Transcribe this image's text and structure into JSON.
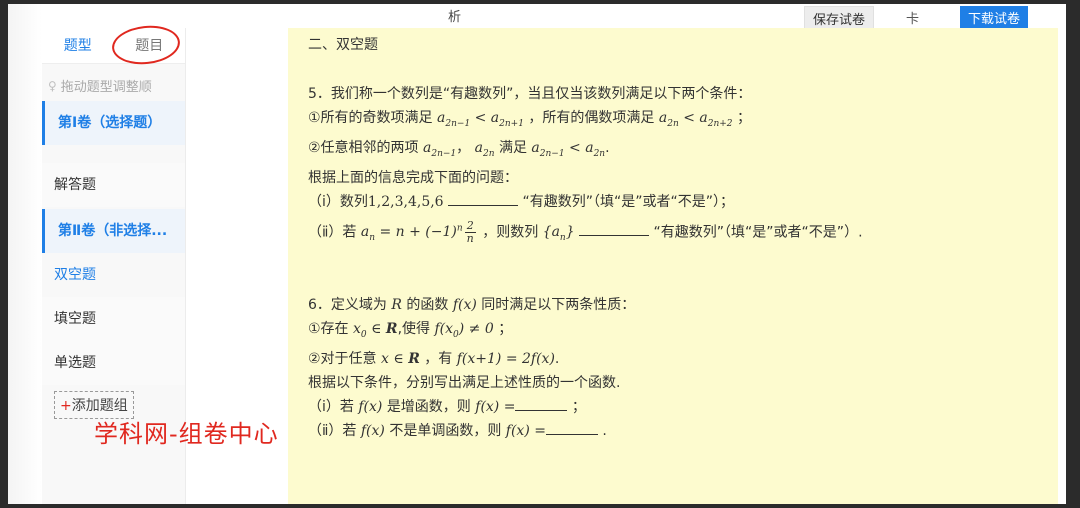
{
  "topbar": {
    "cut_text": "析",
    "save_label": "保存试卷",
    "card_label": "卡",
    "download_label": "下载试卷"
  },
  "sidebar": {
    "tabs": [
      {
        "label": "题型",
        "active": true
      },
      {
        "label": "题目",
        "active": false
      }
    ],
    "drag_tip": "拖动题型调整顺",
    "sections": [
      {
        "label": "第Ⅰ卷（选择题）",
        "kind": "volume"
      },
      {
        "label": "解答题",
        "kind": "plain"
      },
      {
        "label": "第Ⅱ卷（非选择...",
        "kind": "volume"
      },
      {
        "label": "双空题",
        "kind": "selected"
      },
      {
        "label": "填空题",
        "kind": "plain"
      },
      {
        "label": "单选题",
        "kind": "plain"
      }
    ],
    "add_group": {
      "plus": "+",
      "label": "添加题组"
    }
  },
  "watermark": "学科网-组卷中心",
  "paper": {
    "section_heading": "二、双空题",
    "q5": {
      "stem": "5．我们称一个数列是“有趣数列”，当且仅当该数列满足以下两个条件：",
      "c1_prefix": "①所有的奇数项满足",
      "c1_mid": "，所有的偶数项满足",
      "c1_end": "；",
      "c2_prefix": "②任意相邻的两项",
      "c2_comma": "，",
      "c2_mid": "满足",
      "c2_end": ".",
      "instr": "根据上面的信息完成下面的问题：",
      "p1_prefix": "（ⅰ）数列",
      "p1_seq": "1,2,3,4,5,6",
      "p1_suffix": "“有趣数列”（填“是”或者“不是”）；",
      "p2_prefix": "（ⅱ）若",
      "p2_mid": "，则数列",
      "p2_suffix": "“有趣数列”（填“是”或者“不是”）."
    },
    "q6": {
      "stem_prefix": "6．定义域为",
      "stem_mid1": "的函数",
      "stem_mid2": "同时满足以下两条性质：",
      "c1_prefix": "①存在",
      "c1_mid": ",使得",
      "c1_end": "；",
      "c2_prefix": "②对于任意",
      "c2_mid": "，有",
      "c2_end": ".",
      "instr": "根据以下条件，分别写出满足上述性质的一个函数.",
      "p1_prefix": "（ⅰ）若",
      "p1_mid": "是增函数，则",
      "p1_end": "；",
      "p2_prefix": "（ⅱ）若",
      "p2_mid": "不是单调函数，则",
      "p2_end": "."
    }
  }
}
